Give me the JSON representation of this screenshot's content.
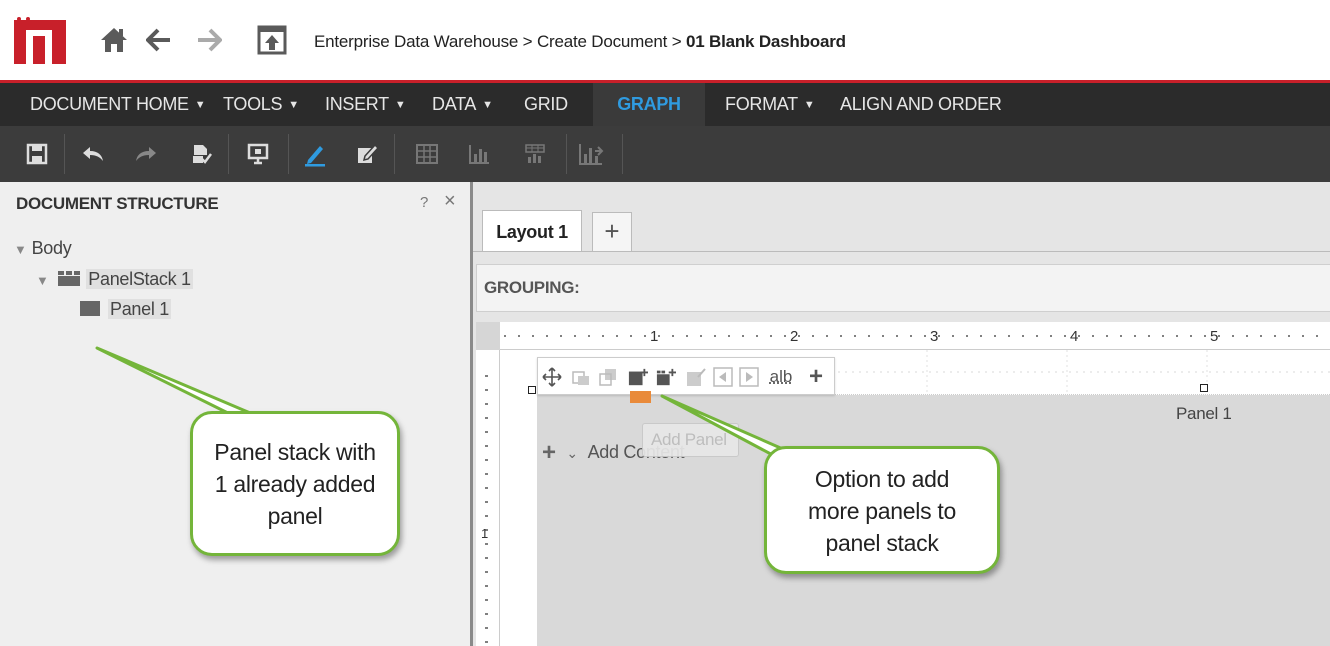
{
  "breadcrumb": {
    "project": "Enterprise Data Warehouse",
    "sep1": ">",
    "step": "Create Document",
    "sep2": ">",
    "current": "01 Blank Dashboard"
  },
  "menu": {
    "document_home": "DOCUMENT HOME",
    "tools": "TOOLS",
    "insert": "INSERT",
    "data": "DATA",
    "grid": "GRID",
    "graph": "GRAPH",
    "format": "FORMAT",
    "align_order": "ALIGN AND ORDER",
    "caret": "▼"
  },
  "structure": {
    "title": "DOCUMENT STRUCTURE",
    "help": "?",
    "close": "×",
    "body": "Body",
    "panelstack": "PanelStack 1",
    "panel": "Panel 1"
  },
  "layout": {
    "tab": "Layout 1",
    "add_tab": "+",
    "grouping": "GROUPING:"
  },
  "ruler": {
    "marks": [
      "1",
      "2",
      "3",
      "4",
      "5"
    ],
    "vmark": "1"
  },
  "canvas": {
    "panel_label": "Panel 1",
    "add_content": "Add Content",
    "tooltip": "Add Panel",
    "text_tool": "alb"
  },
  "callouts": {
    "left": [
      "Panel stack with",
      "1 already added",
      "panel"
    ],
    "right": [
      "Option to add",
      "more panels to",
      "panel stack"
    ]
  },
  "colors": {
    "brand": "#c8202a",
    "accent": "#2f9be0",
    "callout_border": "#74b53a",
    "highlight": "#e98a3a"
  }
}
